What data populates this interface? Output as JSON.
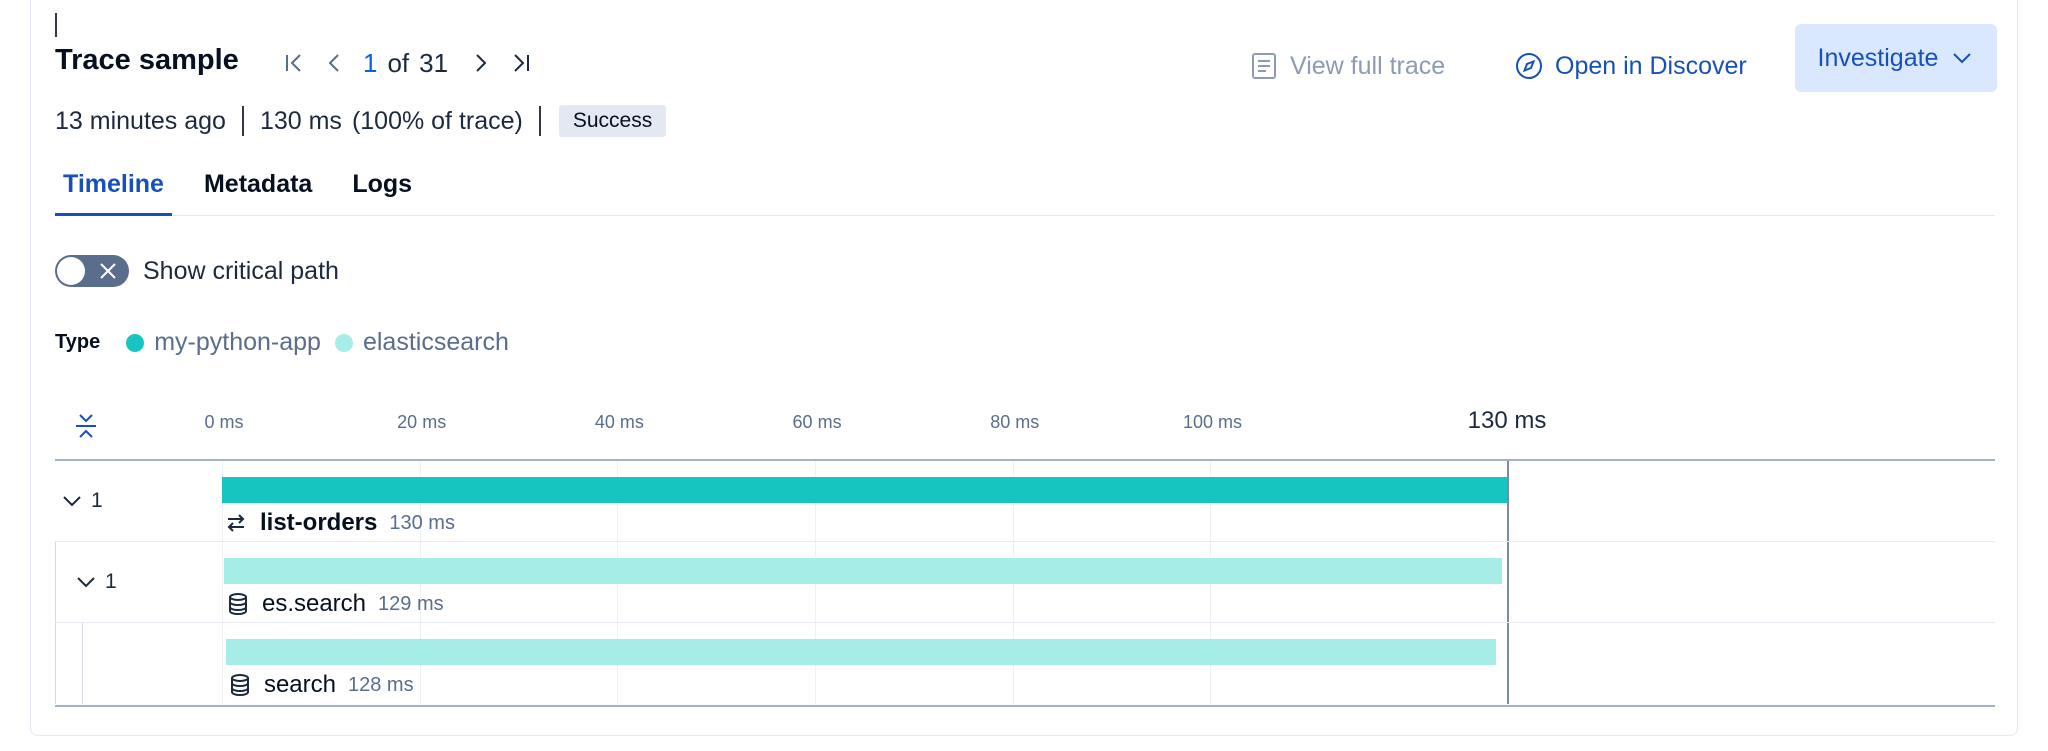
{
  "header": {
    "title": "Trace sample",
    "pager": {
      "current": "1",
      "of_label": "of",
      "total": "31"
    },
    "view_full_trace": "View full trace",
    "open_in_discover": "Open in Discover",
    "investigate": "Investigate"
  },
  "meta": {
    "age": "13 minutes ago",
    "duration": "130 ms",
    "share": "(100% of trace)",
    "status": "Success"
  },
  "tabs": [
    {
      "label": "Timeline",
      "active": true
    },
    {
      "label": "Metadata",
      "active": false
    },
    {
      "label": "Logs",
      "active": false
    }
  ],
  "critical_path": {
    "label": "Show critical path",
    "enabled": false
  },
  "type_legend": {
    "label": "Type",
    "items": [
      {
        "name": "my-python-app",
        "color": "#16c5c0"
      },
      {
        "name": "elasticsearch",
        "color": "#a6ede8"
      }
    ]
  },
  "axis": {
    "ticks": [
      "0 ms",
      "20 ms",
      "40 ms",
      "60 ms",
      "80 ms",
      "100 ms"
    ],
    "tick_values": [
      0,
      20,
      40,
      60,
      80,
      100
    ],
    "end_label": "130 ms",
    "max_ms": 130
  },
  "spans": [
    {
      "count": "1",
      "name": "list-orders",
      "duration": "130 ms",
      "start_ms": 0,
      "duration_ms": 130,
      "color": "#16c5c0",
      "icon": "exchange-icon",
      "bold": true,
      "depth": 0
    },
    {
      "count": "1",
      "name": "es.search",
      "duration": "129 ms",
      "start_ms": 0.2,
      "duration_ms": 129.3,
      "color": "#a6ede8",
      "icon": "database-icon",
      "bold": false,
      "depth": 1
    },
    {
      "count": "",
      "name": "search",
      "duration": "128 ms",
      "start_ms": 0.4,
      "duration_ms": 128.5,
      "color": "#a6ede8",
      "icon": "database-icon",
      "bold": false,
      "depth": 2
    }
  ]
}
